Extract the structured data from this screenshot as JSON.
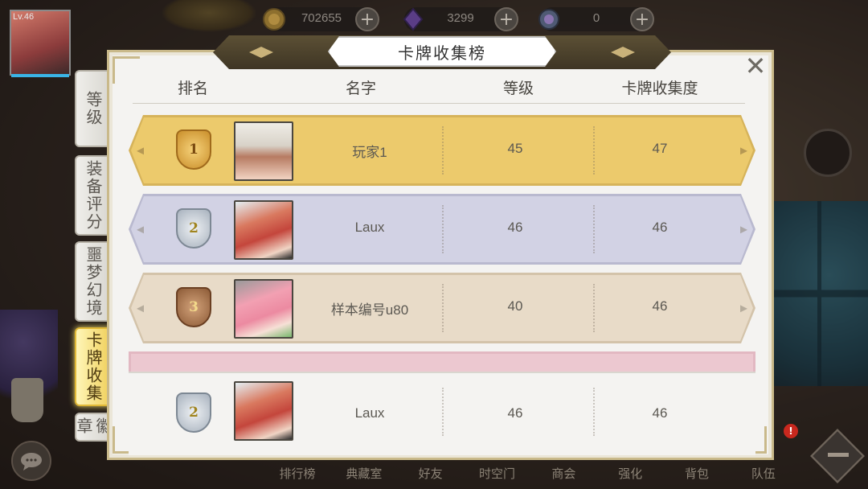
{
  "player": {
    "level": "Lv.46"
  },
  "currencies": [
    {
      "icon": "gold-coin-icon",
      "amount": "702655",
      "plus": "+"
    },
    {
      "icon": "purple-crystal-icon",
      "amount": "3299",
      "plus": "+"
    },
    {
      "icon": "rainbow-orb-icon",
      "amount": "0",
      "plus": "+"
    }
  ],
  "tabs": [
    {
      "label": "等级",
      "active": false
    },
    {
      "label": "装备评分",
      "active": false
    },
    {
      "label": "噩梦幻境",
      "active": false
    },
    {
      "label": "卡牌收集",
      "active": true
    },
    {
      "label": "徽章",
      "active": false
    }
  ],
  "panel": {
    "title": "卡牌收集榜",
    "close": "✕",
    "headers": {
      "rank": "排名",
      "name": "名字",
      "level": "等级",
      "collection": "卡牌收集度"
    }
  },
  "rows": [
    {
      "rank": "1",
      "name": "玩家1",
      "level": "45",
      "collection": "47",
      "color": "#e8c86c",
      "medal_color": "#e2a83a"
    },
    {
      "rank": "2",
      "name": "Laux",
      "level": "46",
      "collection": "46",
      "color": "#cfcfe2",
      "medal_color": "#b9c2cc"
    },
    {
      "rank": "3",
      "name": "样本编号u80",
      "level": "40",
      "collection": "46",
      "color": "#e6d9c6",
      "medal_color": "#a67a54"
    }
  ],
  "own_row": {
    "rank": "2",
    "name": "Laux",
    "level": "46",
    "collection": "46"
  },
  "bottom_nav": [
    "排行榜",
    "典藏室",
    "好友",
    "时空门",
    "商会",
    "强化",
    "背包",
    "队伍"
  ],
  "alert_badge": "!"
}
